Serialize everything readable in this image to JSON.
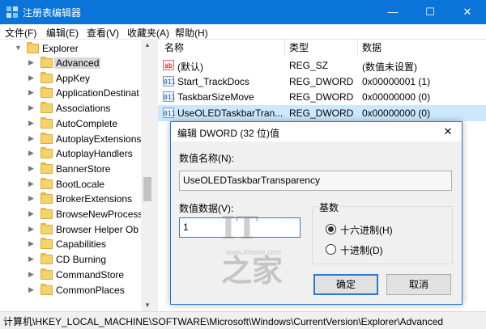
{
  "window": {
    "title": "注册表编辑器",
    "minimize": "—",
    "maximize": "☐",
    "close": "✕"
  },
  "menu": [
    "文件(F)",
    "编辑(E)",
    "查看(V)",
    "收藏夹(A)",
    "帮助(H)"
  ],
  "tree": {
    "root": "Explorer",
    "items": [
      {
        "label": "Advanced",
        "selected": true
      },
      {
        "label": "AppKey"
      },
      {
        "label": "ApplicationDestinat"
      },
      {
        "label": "Associations"
      },
      {
        "label": "AutoComplete"
      },
      {
        "label": "AutoplayExtensions"
      },
      {
        "label": "AutoplayHandlers"
      },
      {
        "label": "BannerStore"
      },
      {
        "label": "BootLocale"
      },
      {
        "label": "BrokerExtensions"
      },
      {
        "label": "BrowseNewProcess"
      },
      {
        "label": "Browser Helper Ob"
      },
      {
        "label": "Capabilities"
      },
      {
        "label": "CD Burning"
      },
      {
        "label": "CommandStore"
      },
      {
        "label": "CommonPlaces"
      }
    ]
  },
  "list": {
    "columns": [
      "名称",
      "类型",
      "数据"
    ],
    "rows": [
      {
        "icon": "ab",
        "name": "(默认)",
        "type": "REG_SZ",
        "data": "(数值未设置)"
      },
      {
        "icon": "dword",
        "name": "Start_TrackDocs",
        "type": "REG_DWORD",
        "data": "0x00000001 (1)"
      },
      {
        "icon": "dword",
        "name": "TaskbarSizeMove",
        "type": "REG_DWORD",
        "data": "0x00000000 (0)"
      },
      {
        "icon": "dword",
        "name": "UseOLEDTaskbarTran...",
        "type": "REG_DWORD",
        "data": "0x00000000 (0)",
        "selected": true
      }
    ]
  },
  "status": "计算机\\HKEY_LOCAL_MACHINE\\SOFTWARE\\Microsoft\\Windows\\CurrentVersion\\Explorer\\Advanced",
  "dialog": {
    "title": "编辑 DWORD (32 位)值",
    "close": "✕",
    "name_label": "数值名称(N):",
    "name_value": "UseOLEDTaskbarTransparency",
    "data_label": "数值数据(V):",
    "data_value": "1",
    "base_label": "基数",
    "hex_label": "十六进制(H)",
    "dec_label": "十进制(D)",
    "base_selected": "hex",
    "ok": "确定",
    "cancel": "取消"
  },
  "watermark": {
    "logo": "IT之家",
    "url": "www.ithome.com"
  },
  "colors": {
    "titlebar": "#0a74d8",
    "selection": "#cce8ff",
    "accent": "#2b78d0"
  }
}
